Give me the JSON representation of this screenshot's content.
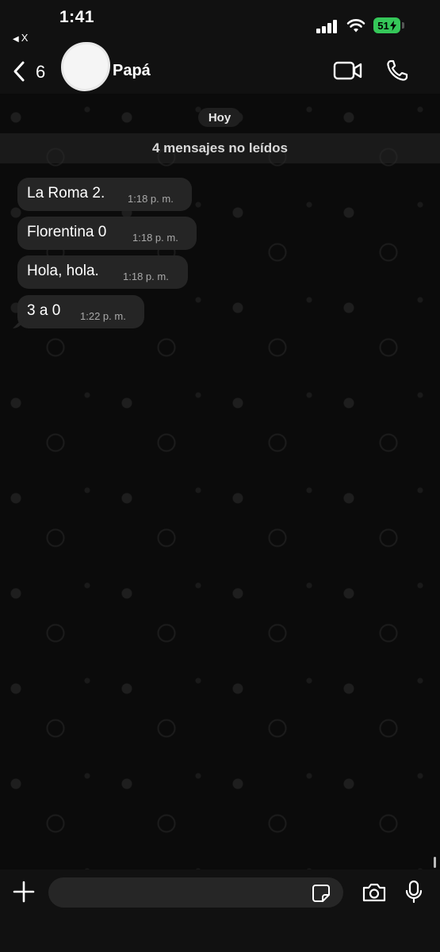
{
  "status_bar": {
    "time": "1:41",
    "back_app_label": "X",
    "battery_level": "51",
    "battery_charging": true,
    "battery_color": "#35c759"
  },
  "header": {
    "unread_count": "6",
    "contact_name": "Papá"
  },
  "chat": {
    "date_chip": "Hoy",
    "unread_banner": "4 mensajes no leídos",
    "messages": [
      {
        "text": "La Roma 2.",
        "time": "1:18 p. m."
      },
      {
        "text": "Florentina 0",
        "time": "1:18 p. m."
      },
      {
        "text": "Hola, hola.",
        "time": "1:18 p. m."
      },
      {
        "text": "3 a 0",
        "time": "1:22 p. m."
      }
    ]
  },
  "input_bar": {
    "placeholder": "",
    "value": ""
  },
  "icons": {
    "back": "chevron-left-icon",
    "video": "video-camera-icon",
    "phone": "phone-icon",
    "plus": "plus-icon",
    "sticker": "sticker-icon",
    "camera": "camera-icon",
    "mic": "microphone-icon"
  }
}
